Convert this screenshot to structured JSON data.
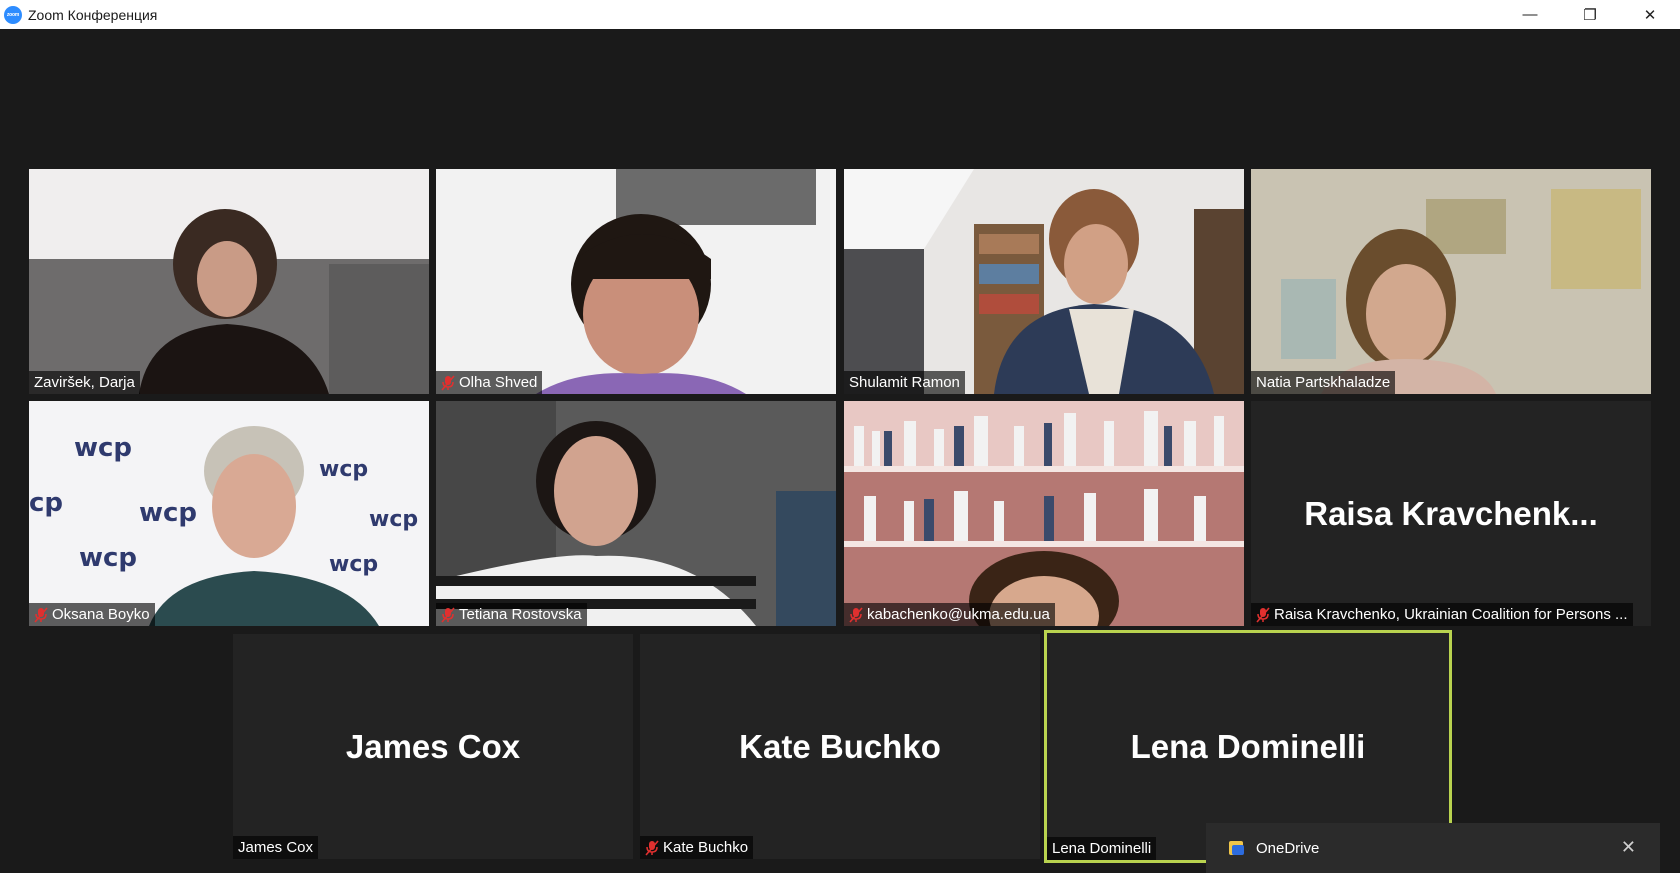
{
  "window": {
    "title": "Zoom Конференция",
    "app_icon_label": "zoom"
  },
  "controls": {
    "minimize": "—",
    "maximize": "❐",
    "close": "✕"
  },
  "participants": [
    {
      "name": "Zaviršek, Darja",
      "muted": false,
      "video": true
    },
    {
      "name": "Olha Shved",
      "muted": true,
      "video": true
    },
    {
      "name": "Shulamit Ramon",
      "muted": false,
      "video": true
    },
    {
      "name": "Natia Partskhaladze",
      "muted": false,
      "video": true
    },
    {
      "name": "Oksana Boyko",
      "muted": true,
      "video": true
    },
    {
      "name": "Tetiana Rostovska",
      "muted": true,
      "video": true
    },
    {
      "name": "kabachenko@ukma.edu.ua",
      "muted": true,
      "video": true
    },
    {
      "name": "Raisa Kravchenko, Ukrainian Coalition for Persons ...",
      "display": "Raisa  Kravchenk...",
      "muted": true,
      "video": false
    },
    {
      "name": "James Cox",
      "display": "James Cox",
      "muted": false,
      "video": false
    },
    {
      "name": "Kate Buchko",
      "display": "Kate Buchko",
      "muted": true,
      "video": false
    },
    {
      "name": "Lena Dominelli",
      "display": "Lena Dominelli",
      "muted": false,
      "video": false,
      "active_speaker": true
    }
  ],
  "toast": {
    "label": "OneDrive",
    "close": "✕"
  },
  "colors": {
    "background": "#1a1a1a",
    "active_speaker": "#c8e05a",
    "muted_icon": "#e0302f"
  }
}
